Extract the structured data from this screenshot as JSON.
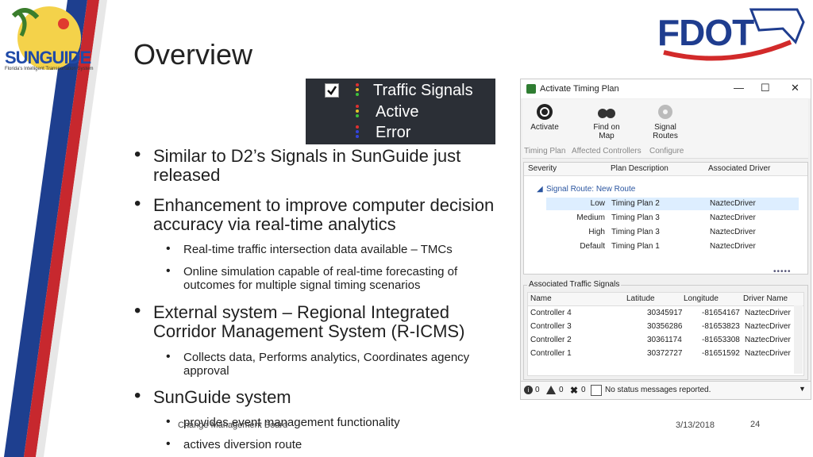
{
  "logo_left": {
    "name": "SUNGUIDE",
    "tagline": "Florida's Intelligent Transportation System"
  },
  "logo_right": {
    "name": "FDOT"
  },
  "title": "Overview",
  "legend": {
    "items": [
      "Traffic Signals",
      "Active",
      "Error"
    ]
  },
  "bullets": [
    {
      "text_lines": [
        "Similar to D2’s Signals in SunGuide just",
        "released"
      ]
    },
    {
      "text_lines": [
        "Enhancement to improve computer decision",
        "accuracy via real-time analytics"
      ]
    },
    {
      "sub": [
        "Real-time traffic intersection data available – TMCs"
      ]
    },
    {
      "sub_lines": [
        "Online simulation capable of real-time forecasting of",
        "outcomes for multiple signal timing scenarios"
      ]
    },
    {
      "text_lines": [
        "External system – Regional Integrated",
        "Corridor Management System (R-ICMS)"
      ]
    },
    {
      "sub_lines": [
        "Collects data, Performs analytics, Coordinates agency",
        "approval"
      ]
    },
    {
      "text_lines": [
        "SunGuide system"
      ]
    },
    {
      "sub": [
        "provides event management functionality"
      ]
    },
    {
      "sub": [
        "actives diversion route"
      ]
    }
  ],
  "window": {
    "title": "Activate Timing Plan",
    "controls": [
      "—",
      "☐",
      "✕"
    ],
    "toolbar": {
      "buttons": [
        {
          "label1": "Activate",
          "label2": ""
        },
        {
          "label1": "Find on",
          "label2": "Map"
        },
        {
          "label1": "Signal",
          "label2": "Routes"
        }
      ],
      "groups": [
        "Timing Plan",
        "Affected Controllers",
        "Configure"
      ]
    },
    "plans": {
      "headers": [
        "Severity",
        "Plan Description",
        "Associated Driver"
      ],
      "group": "Signal Route: New Route",
      "rows": [
        [
          "Low",
          "Timing Plan 2",
          "NaztecDriver"
        ],
        [
          "Medium",
          "Timing Plan 3",
          "NaztecDriver"
        ],
        [
          "High",
          "Timing Plan 3",
          "NaztecDriver"
        ],
        [
          "Default",
          "Timing Plan 1",
          "NaztecDriver"
        ]
      ]
    },
    "signals": {
      "group_label": "Associated Traffic Signals",
      "headers": [
        "Name",
        "Latitude",
        "Longitude",
        "Driver Name"
      ],
      "rows": [
        [
          "Controller 4",
          "30345917",
          "-81654167",
          "NaztecDriver"
        ],
        [
          "Controller 3",
          "30356286",
          "-81653823",
          "NaztecDriver"
        ],
        [
          "Controller 2",
          "30361174",
          "-81653308",
          "NaztecDriver"
        ],
        [
          "Controller 1",
          "30372727",
          "-81651592",
          "NaztecDriver"
        ]
      ]
    },
    "status": {
      "errors": "0",
      "warnings": "0",
      "closed": "0",
      "message": "No status messages reported."
    }
  },
  "footer": {
    "left": "Change Management Board",
    "date": "3/13/2018",
    "page": "24"
  }
}
